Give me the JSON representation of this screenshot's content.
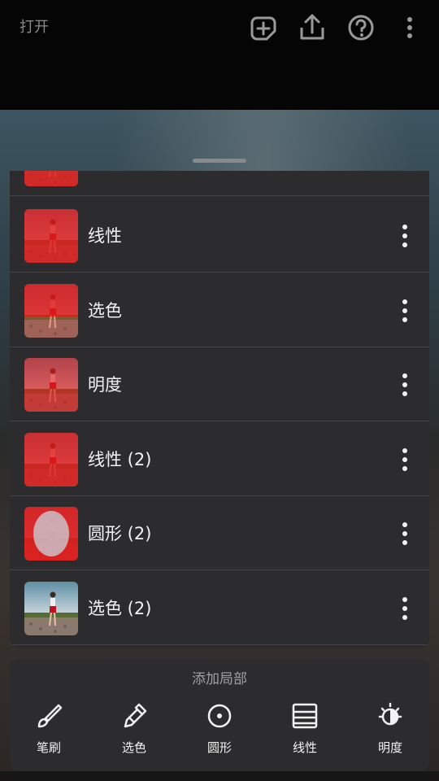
{
  "header": {
    "open_label": "打开",
    "icons": [
      "add-layer-icon",
      "share-icon",
      "help-icon",
      "more-vertical-icon"
    ]
  },
  "masks": {
    "items": [
      {
        "label": "",
        "thumb": "red-full"
      },
      {
        "label": "线性",
        "thumb": "red-full"
      },
      {
        "label": "选色",
        "thumb": "red-top"
      },
      {
        "label": "明度",
        "thumb": "red-mid"
      },
      {
        "label": "线性 (2)",
        "thumb": "red-full"
      },
      {
        "label": "圆形 (2)",
        "thumb": "red-ring"
      },
      {
        "label": "选色 (2)",
        "thumb": "natural"
      }
    ]
  },
  "add_local": {
    "title": "添加局部",
    "tools": [
      {
        "label": "笔刷",
        "icon": "brush-icon"
      },
      {
        "label": "选色",
        "icon": "eyedropper-icon"
      },
      {
        "label": "圆形",
        "icon": "radial-icon"
      },
      {
        "label": "线性",
        "icon": "linear-gradient-icon"
      },
      {
        "label": "明度",
        "icon": "brightness-icon"
      }
    ]
  },
  "colors": {
    "accent_red": "#e01a1a",
    "panel_bg": "#2c2c2e",
    "divider": "#444446"
  }
}
